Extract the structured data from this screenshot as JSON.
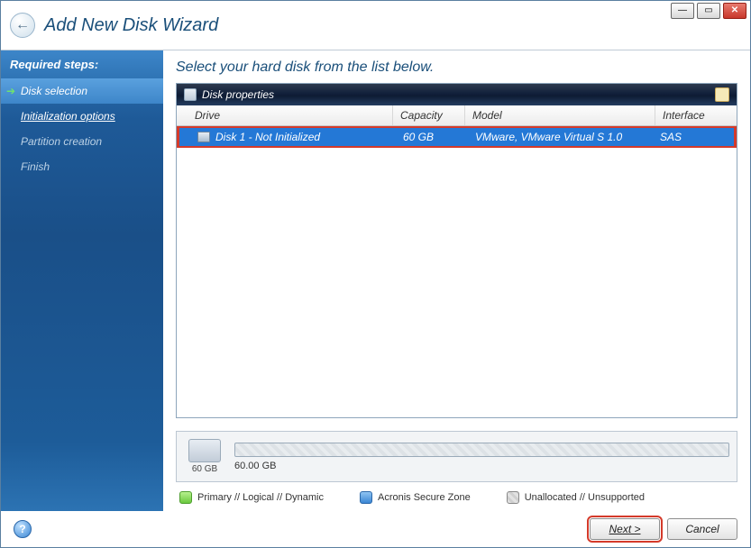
{
  "window": {
    "title": "Add New Disk Wizard"
  },
  "sidebar": {
    "header": "Required steps:",
    "steps": [
      {
        "label": "Disk selection"
      },
      {
        "label": "Initialization options"
      },
      {
        "label": "Partition creation"
      },
      {
        "label": "Finish"
      }
    ]
  },
  "content": {
    "heading": "Select your hard disk from the list below.",
    "panel_title": "Disk properties",
    "columns": {
      "drive": "Drive",
      "capacity": "Capacity",
      "model": "Model",
      "interface": "Interface"
    },
    "rows": [
      {
        "drive": "Disk 1 - Not Initialized",
        "capacity": "60 GB",
        "model": "VMware, VMware Virtual S 1.0",
        "interface": "SAS"
      }
    ],
    "diskmap": {
      "thumb_label": "60 GB",
      "bar_label": "60.00 GB"
    },
    "legend": {
      "primary": "Primary // Logical // Dynamic",
      "secure": "Acronis Secure Zone",
      "unalloc": "Unallocated // Unsupported"
    }
  },
  "footer": {
    "next": "Next >",
    "cancel": "Cancel"
  }
}
